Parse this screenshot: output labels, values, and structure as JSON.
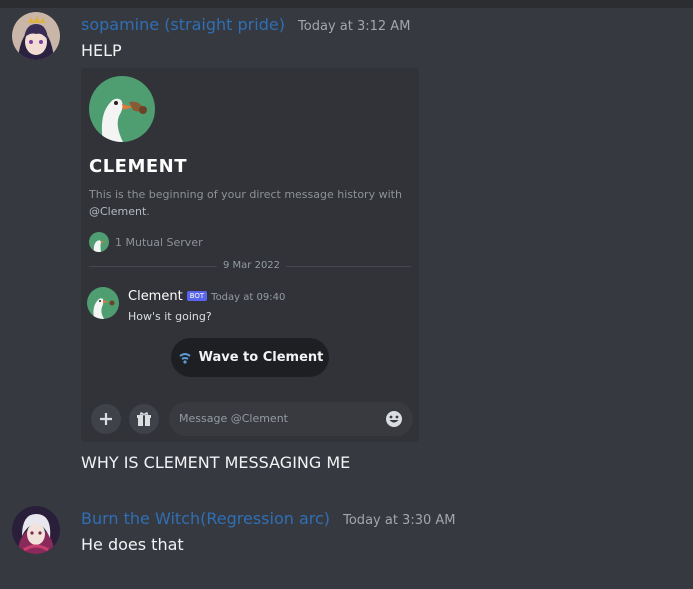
{
  "messages": [
    {
      "username": "sopamine (straight pride)",
      "timestamp": "Today at 3:12 AM",
      "lines": [
        "HELP",
        "WHY IS CLEMENT MESSAGING ME"
      ]
    },
    {
      "username": "Burn the Witch(Regression arc)",
      "timestamp": "Today at 3:30 AM",
      "lines": [
        "He does that"
      ]
    }
  ],
  "embed": {
    "title": "CLEMENT",
    "intro_text": "This is the beginning of your direct message history with",
    "intro_mention": "@Clement",
    "intro_end": ".",
    "mutual": "1 Mutual Server",
    "date_divider": "9 Mar 2022",
    "bot_message": {
      "name": "Clement",
      "tag": "BOT",
      "time": "Today at 09:40",
      "text": "How's it going?"
    },
    "wave_button": "Wave to Clement",
    "composer_placeholder": "Message @Clement",
    "icons": {
      "add": "plus-icon",
      "gift": "gift-icon",
      "emoji": "emoji-icon",
      "wave": "wave-icon"
    }
  },
  "colors": {
    "background": "#36393f",
    "username": "#2f6fb5",
    "bot_tag": "#5865f2",
    "goose_green": "#4e9e72"
  }
}
